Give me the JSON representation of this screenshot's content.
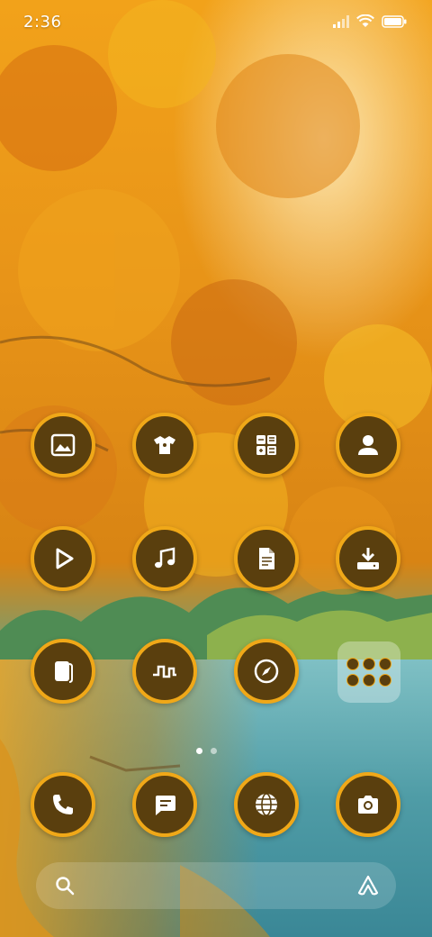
{
  "status_bar": {
    "time": "2:36",
    "icons": [
      "signal-icon",
      "wifi-icon",
      "battery-icon"
    ]
  },
  "theme": {
    "icon_fill": "#5a3f0e",
    "icon_ring": "#f0a818",
    "glyph": "#ffffff"
  },
  "home_grid": [
    {
      "name": "gallery-app",
      "icon": "image-icon"
    },
    {
      "name": "themes-app",
      "icon": "tshirt-icon"
    },
    {
      "name": "calculator-app",
      "icon": "calculator-icon"
    },
    {
      "name": "contacts-app",
      "icon": "person-icon"
    },
    {
      "name": "video-app",
      "icon": "play-icon"
    },
    {
      "name": "music-app",
      "icon": "music-note-icon"
    },
    {
      "name": "notes-app",
      "icon": "document-icon"
    },
    {
      "name": "downloads-app",
      "icon": "download-icon"
    },
    {
      "name": "wallet-app",
      "icon": "card-icon"
    },
    {
      "name": "recorder-app",
      "icon": "waveform-icon"
    },
    {
      "name": "compass-app",
      "icon": "compass-icon"
    }
  ],
  "folder": {
    "apps": 6
  },
  "dock": [
    {
      "name": "phone-app",
      "icon": "phone-icon"
    },
    {
      "name": "messages-app",
      "icon": "message-icon"
    },
    {
      "name": "browser-app",
      "icon": "globe-icon"
    },
    {
      "name": "camera-app",
      "icon": "camera-icon"
    }
  ],
  "pager": {
    "pages": 2,
    "current": 1
  },
  "search": {
    "icons": [
      "search-icon",
      "assistant-icon"
    ]
  }
}
